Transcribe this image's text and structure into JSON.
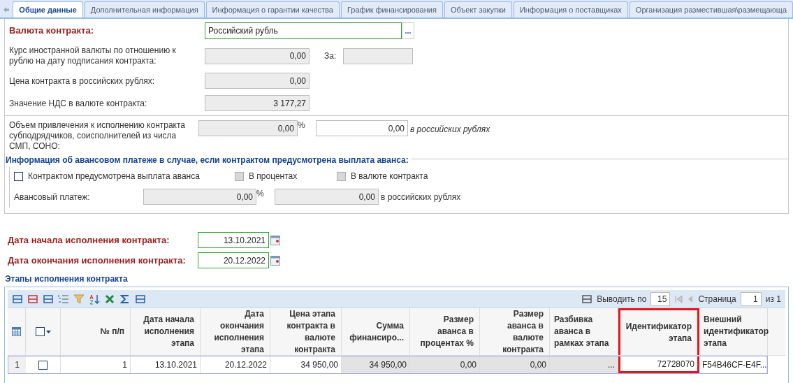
{
  "tabs": [
    {
      "label": "Общие данные",
      "selected": true
    },
    {
      "label": "Дополнительная информация",
      "selected": false
    },
    {
      "label": "Информация о гарантии качества",
      "selected": false
    },
    {
      "label": "График финансирования",
      "selected": false
    },
    {
      "label": "Объект закупки",
      "selected": false
    },
    {
      "label": "Информация о поставщиках",
      "selected": false
    },
    {
      "label": "Организация разместившая\\размещающа",
      "selected": false
    }
  ],
  "currency": {
    "label": "Валюта контракта:",
    "value": "Российский рубль",
    "required": true,
    "button": "..."
  },
  "rate": {
    "label": "Курс иностранной валюты по отношению к рублю на дату подписания контракта:",
    "value": "0,00",
    "disabled": true,
    "for_label": "За:",
    "for_disabled": true
  },
  "amounts": [
    {
      "label": "Цена контракта в российских рублях:",
      "value": "0,00",
      "disabled": true
    },
    {
      "label": "Значение НДС в валюте контракта:",
      "value": "3 177,27",
      "disabled": true
    }
  ],
  "subcontract": {
    "label": "Объем привлечения к исполнению контракта субподрядчиков, соисполнителей из числа СМП, СОНО:",
    "percent_value": "0,00",
    "percent_disabled": true,
    "percent_unit": "%",
    "rub_value": "0,00",
    "rub_disabled": false,
    "rub_unit": "в российских рублях"
  },
  "advance": {
    "legend": "Информация об авансовом платеже в случае, если контрактом предусмотрена выплата аванса:",
    "checkboxes": [
      {
        "label": "Контрактом предусмотрена выплата аванса",
        "checked": false,
        "disabled": false
      },
      {
        "label": "В процентах",
        "checked": false,
        "disabled": true
      },
      {
        "label": "В валюте контракта",
        "checked": false,
        "disabled": true
      }
    ],
    "label": "Авансовый платеж:",
    "percent_value": "0,00",
    "percent_disabled": true,
    "percent_unit": "%",
    "rub_value": "0,00",
    "rub_disabled": true,
    "rub_unit": "в российских рублях"
  },
  "dates": [
    {
      "label": "Дата начала исполнения контракта:",
      "value": "13.10.2021",
      "required": true
    },
    {
      "label": "Дата окончания исполнения контракта:",
      "value": "20.12.2022",
      "required": true
    }
  ],
  "stages": {
    "title": "Этапы исполнения контракта",
    "select_all_checked": false,
    "pager": {
      "per_page_label": "Выводить по",
      "per_page": "15",
      "page_label": "Страница",
      "page": "1",
      "of": "из 1"
    },
    "columns": [
      {
        "label": "№ п/п",
        "highlighted": false
      },
      {
        "label": "Дата начала исполнения этапа",
        "highlighted": false
      },
      {
        "label": "Дата окончания исполнения этапа",
        "highlighted": false
      },
      {
        "label": "Цена этапа контракта в валюте контракта",
        "highlighted": false
      },
      {
        "label": "Сумма финансиро...",
        "highlighted": false
      },
      {
        "label": "Размер аванса в процентах %",
        "highlighted": false
      },
      {
        "label": "Размер аванса в валюте контракта",
        "highlighted": false
      },
      {
        "label": "Разбивка аванса в рамках этапа",
        "highlighted": false
      },
      {
        "label": "Идентификатор этапа",
        "highlighted": true
      },
      {
        "label": "Внешний идентификатор этапа",
        "highlighted": false
      }
    ],
    "rows": [
      {
        "index": "1",
        "checked": false,
        "cells": [
          {
            "text": "1",
            "readonly": false
          },
          {
            "text": "13.10.2021",
            "readonly": false
          },
          {
            "text": "20.12.2022",
            "readonly": false
          },
          {
            "text": "34 950,00",
            "readonly": false
          },
          {
            "text": "34 950,00",
            "readonly": true
          },
          {
            "text": "0,00",
            "readonly": true
          },
          {
            "text": "0,00",
            "readonly": true
          },
          {
            "text": "...",
            "readonly": true
          },
          {
            "text": "72728070",
            "readonly": false
          },
          {
            "text": "F54B46CF-E4F...",
            "readonly": false
          }
        ]
      }
    ]
  }
}
